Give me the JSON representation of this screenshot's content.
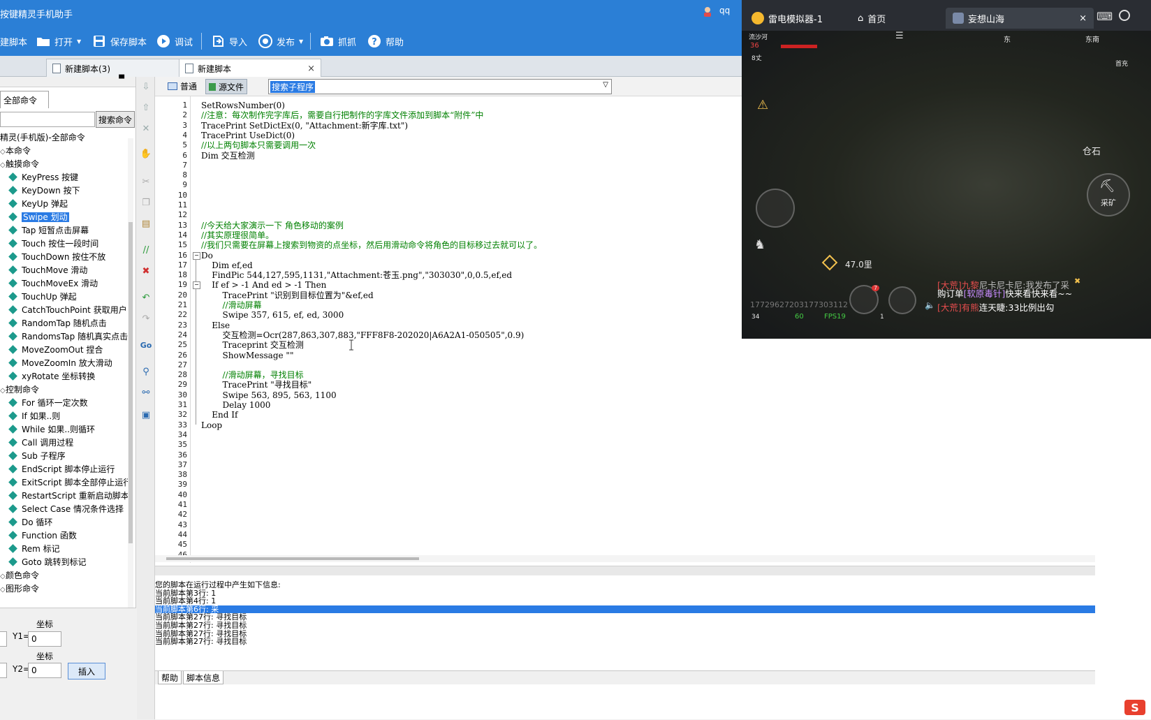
{
  "app": {
    "title": "按键精灵手机助手",
    "user": "qq",
    "toolbar": {
      "new_label": "建脚本",
      "open_label": "打开",
      "save_label": "保存脚本",
      "debug_label": "调试",
      "import_label": "导入",
      "publish_label": "发布",
      "capture_label": "抓抓",
      "help_label": "帮助"
    },
    "tabs": [
      {
        "label": "新建脚本(3)"
      },
      {
        "label": "新建脚本",
        "close": "×"
      }
    ]
  },
  "left_panel": {
    "tab_label": "全部命令",
    "search_button": "搜索命令",
    "search_value": "",
    "tree": [
      {
        "label": "精灵(手机版)-全部命令",
        "kind": "root"
      },
      {
        "label": "本命令",
        "kind": "group"
      },
      {
        "label": "触摸命令",
        "kind": "group"
      },
      {
        "label": "KeyPress 按键",
        "kind": "item"
      },
      {
        "label": "KeyDown 按下",
        "kind": "item"
      },
      {
        "label": "KeyUp 弹起",
        "kind": "item"
      },
      {
        "label": "Swipe 划动",
        "kind": "item",
        "selected": true
      },
      {
        "label": "Tap 短暂点击屏幕",
        "kind": "item"
      },
      {
        "label": "Touch 按住一段时间",
        "kind": "item"
      },
      {
        "label": "TouchDown 按住不放",
        "kind": "item"
      },
      {
        "label": "TouchMove 滑动",
        "kind": "item"
      },
      {
        "label": "TouchMoveEx 滑动",
        "kind": "item"
      },
      {
        "label": "TouchUp 弹起",
        "kind": "item"
      },
      {
        "label": "CatchTouchPoint 获取用户",
        "kind": "item"
      },
      {
        "label": "RandomTap 随机点击",
        "kind": "item"
      },
      {
        "label": "RandomsTap 随机真实点击",
        "kind": "item"
      },
      {
        "label": "MoveZoomOut 捏合",
        "kind": "item"
      },
      {
        "label": "MoveZoomIn 放大滑动",
        "kind": "item"
      },
      {
        "label": "xyRotate 坐标转换",
        "kind": "item"
      },
      {
        "label": "控制命令",
        "kind": "group"
      },
      {
        "label": "For 循环一定次数",
        "kind": "item"
      },
      {
        "label": "If 如果..则",
        "kind": "item"
      },
      {
        "label": "While 如果..则循环",
        "kind": "item"
      },
      {
        "label": "Call 调用过程",
        "kind": "item"
      },
      {
        "label": "Sub 子程序",
        "kind": "item"
      },
      {
        "label": "EndScript 脚本停止运行",
        "kind": "item"
      },
      {
        "label": "ExitScript 脚本全部停止运行",
        "kind": "item"
      },
      {
        "label": "RestartScript 重新启动脚本",
        "kind": "item"
      },
      {
        "label": "Select Case 情况条件选择",
        "kind": "item"
      },
      {
        "label": "Do 循环",
        "kind": "item"
      },
      {
        "label": "Function 函数",
        "kind": "item"
      },
      {
        "label": "Rem 标记",
        "kind": "item"
      },
      {
        "label": "Goto 跳转到标记",
        "kind": "item"
      },
      {
        "label": "颜色命令",
        "kind": "group"
      },
      {
        "label": "图形命令",
        "kind": "group"
      }
    ],
    "coords": {
      "label1": "坐标",
      "y1_label": "Y1=",
      "y1_value": "0",
      "label2": "坐标",
      "y2_label": "Y2=",
      "y2_value": "0",
      "insert_button": "插入"
    }
  },
  "editor": {
    "mode_normal": "普通",
    "mode_source": "源文件",
    "sub_search": "搜索子程序",
    "lines": [
      "SetRowsNumber(0)",
      "//注意：每次制作完字库后，需要自行把制作的字库文件添加到脚本“附件”中",
      "TracePrint SetDictEx(0, \"Attachment:新字库.txt\")",
      "TracePrint UseDict(0)",
      "//以上两句脚本只需要调用一次",
      "Dim 交互检测",
      "",
      "",
      "",
      "",
      "",
      "",
      "//今天给大家演示一下 角色移动的案例",
      "//其实原理很简单。",
      "//我们只需要在屏幕上搜索到物资的点坐标，然后用滑动命令将角色的目标移过去就可以了。",
      "Do",
      "    Dim ef,ed",
      "    FindPic 544,127,595,1131,\"Attachment:苍玉.png\",\"303030\",0,0.5,ef,ed",
      "    If ef > -1 And ed > -1 Then",
      "        TracePrint \"识别到目标位置为\"&ef,ed",
      "        //滑动屏幕",
      "        Swipe 357, 615, ef, ed, 3000",
      "    Else",
      "        交互检测=Ocr(287,863,307,883,\"FFF8F8-202020|A6A2A1-050505\",0.9)",
      "        Traceprint 交互检测",
      "        ShowMessage \"\"",
      "",
      "        //滑动屏幕，寻找目标",
      "        TracePrint \"寻找目标\"",
      "        Swipe 563, 895, 563, 1100",
      "        Delay 1000",
      "    End If",
      "Loop",
      "",
      "",
      "",
      "",
      "",
      "",
      "",
      "",
      "",
      "",
      "",
      "",
      ""
    ],
    "line_count": 46
  },
  "output": {
    "lines": [
      {
        "text": "您的脚本在运行过程中产生如下信息:"
      },
      {
        "text": "当前脚本第3行: 1"
      },
      {
        "text": "当前脚本第4行: 1"
      },
      {
        "text": "当前脚本第6行: 采",
        "highlight": true
      },
      {
        "text": "当前脚本第27行: 寻找目标"
      },
      {
        "text": "当前脚本第27行: 寻找目标"
      },
      {
        "text": "当前脚本第27行: 寻找目标"
      },
      {
        "text": "当前脚本第27行: 寻找目标"
      }
    ],
    "tab_help": "帮助",
    "tab_info": "脚本信息"
  },
  "emulator": {
    "title": "雷电模拟器-1",
    "home_tab": "首页",
    "game_tab": "妄想山海",
    "close": "×",
    "hud": {
      "loc": "流沙河",
      "temp": "36",
      "height": "8丈",
      "compass_e1": "东",
      "compass_se": "东南",
      "first_charge": "首充",
      "mineral": "仓石",
      "mine_btn": "采矿",
      "distance": "47.0里",
      "badge": "7",
      "uid": "17729627203177303112",
      "ping": "34",
      "wifi": "60",
      "fps": "FPS19",
      "coin": "1"
    },
    "chat": [
      {
        "tag": "[大荒]",
        "name": "九黎",
        "text": "尼卡尼卡尼:我发布了采"
      },
      {
        "tag": "",
        "name": "",
        "text": "购订单",
        "link": "[软原毒针]",
        "rest": "快来看快来看~~"
      },
      {
        "tag": "[大荒]",
        "name": "有熊",
        "text": "连天睫:33比例出勾"
      }
    ]
  }
}
